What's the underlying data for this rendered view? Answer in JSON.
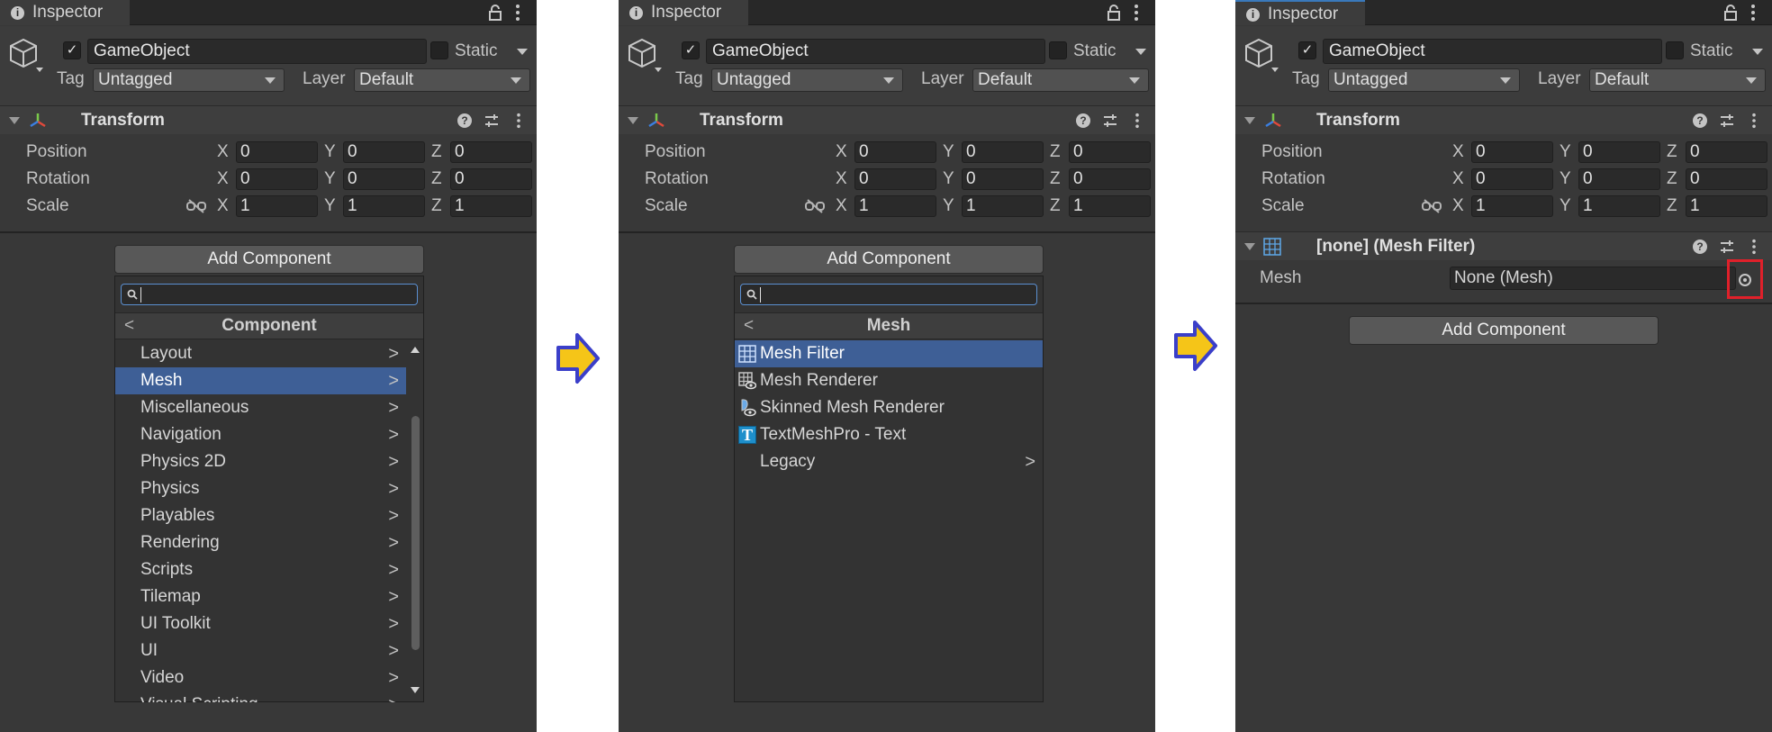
{
  "inspector": {
    "tab_title": "Inspector",
    "icons": {
      "tab": "info-icon",
      "lock": "lock-icon",
      "menu": "kebab-menu-icon",
      "object": "cube-icon"
    },
    "gameobject": {
      "active_check": "✓",
      "name": "GameObject",
      "static_label": "Static",
      "tag_label": "Tag",
      "tag_value": "Untagged",
      "layer_label": "Layer",
      "layer_value": "Default"
    },
    "transform": {
      "title": "Transform",
      "help": "?",
      "rows": [
        {
          "label": "Position",
          "x": "0",
          "y": "0",
          "z": "0"
        },
        {
          "label": "Rotation",
          "x": "0",
          "y": "0",
          "z": "0"
        },
        {
          "label": "Scale",
          "x": "1",
          "y": "1",
          "z": "1"
        }
      ],
      "axis_x": "X",
      "axis_y": "Y",
      "axis_z": "Z"
    },
    "add_component_label": "Add Component"
  },
  "step1": {
    "popup_title": "Component",
    "back": "<",
    "items": [
      "Layout",
      "Mesh",
      "Miscellaneous",
      "Navigation",
      "Physics 2D",
      "Physics",
      "Playables",
      "Rendering",
      "Scripts",
      "Tilemap",
      "UI Toolkit",
      "UI",
      "Video",
      "Visual Scripting"
    ],
    "selected": "Mesh",
    "chevron": ">"
  },
  "step2": {
    "popup_title": "Mesh",
    "back": "<",
    "items": [
      {
        "label": "Mesh Filter",
        "icon": "mesh-filter-icon",
        "selected": true
      },
      {
        "label": "Mesh Renderer",
        "icon": "mesh-renderer-icon",
        "selected": false
      },
      {
        "label": "Skinned Mesh Renderer",
        "icon": "skinned-mesh-renderer-icon",
        "selected": false
      },
      {
        "label": "TextMeshPro - Text",
        "icon": "textmeshpro-icon",
        "icon_glyph": "T",
        "selected": false
      },
      {
        "label": "Legacy",
        "icon": "",
        "selected": false,
        "submenu": true
      }
    ],
    "chevron": ">"
  },
  "step3": {
    "component_title": "[none] (Mesh Filter)",
    "mesh_label": "Mesh",
    "mesh_value": "None (Mesh)",
    "highlight_color": "#e0202a"
  },
  "colors": {
    "panel_bg": "#383838",
    "selection": "#3e5f96",
    "arrow_fill": "#f5c518",
    "arrow_stroke": "#3b3fc9"
  }
}
